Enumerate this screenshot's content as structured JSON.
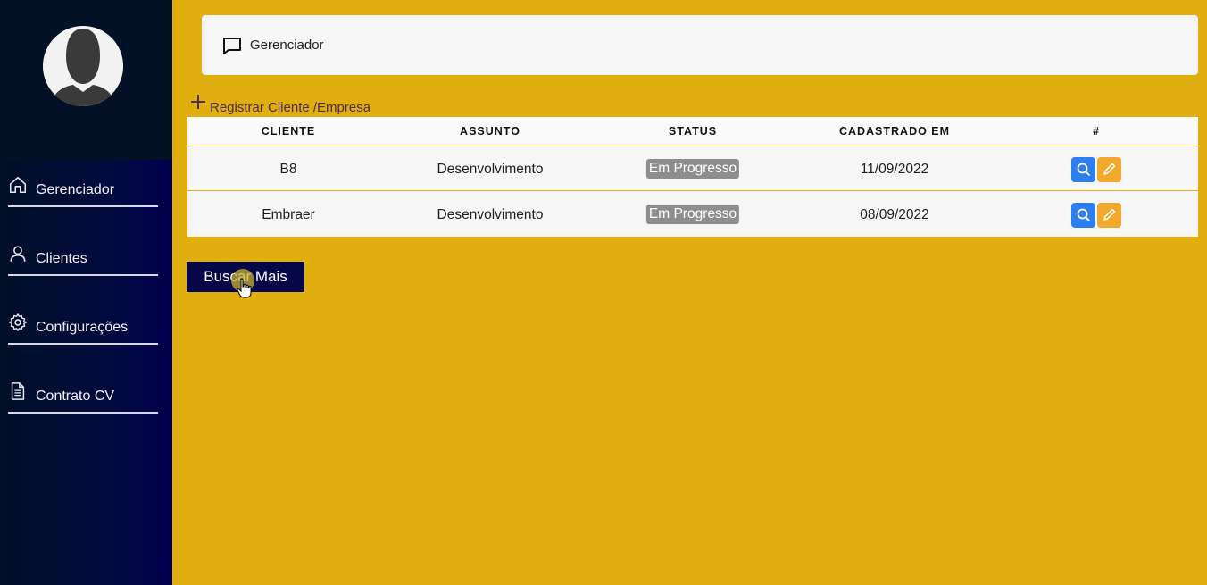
{
  "sidebar": {
    "avatar_icon": "user-silhouette",
    "items": [
      {
        "label": "Gerenciador",
        "icon": "home-icon"
      },
      {
        "label": "Clientes",
        "icon": "user-icon"
      },
      {
        "label": "Configurações",
        "icon": "gear-icon"
      },
      {
        "label": "Contrato CV",
        "icon": "document-icon"
      }
    ]
  },
  "header": {
    "title": "Gerenciador",
    "icon": "chat-icon"
  },
  "register_link": {
    "label": "Registrar Cliente /Empresa",
    "icon": "plus-icon"
  },
  "table": {
    "columns": [
      "CLIENTE",
      "ASSUNTO",
      "STATUS",
      "CADASTRADO EM",
      "#"
    ],
    "rows": [
      {
        "cliente": "B8",
        "assunto": "Desenvolvimento",
        "status": "Em Progresso",
        "cadastrado_em": "11/09/2022"
      },
      {
        "cliente": "Embraer",
        "assunto": "Desenvolvimento",
        "status": "Em Progresso",
        "cadastrado_em": "08/09/2022"
      }
    ],
    "actions": [
      "search-icon",
      "pencil-icon"
    ]
  },
  "buscar_button": {
    "label": "Buscar Mais"
  },
  "colors": {
    "background": "#e0ae0e",
    "sidebar": "#020b3d",
    "button": "#060749",
    "status_badge": "#8d8d8d",
    "view_button": "#2d7ff0",
    "edit_button": "#f2a92b"
  }
}
